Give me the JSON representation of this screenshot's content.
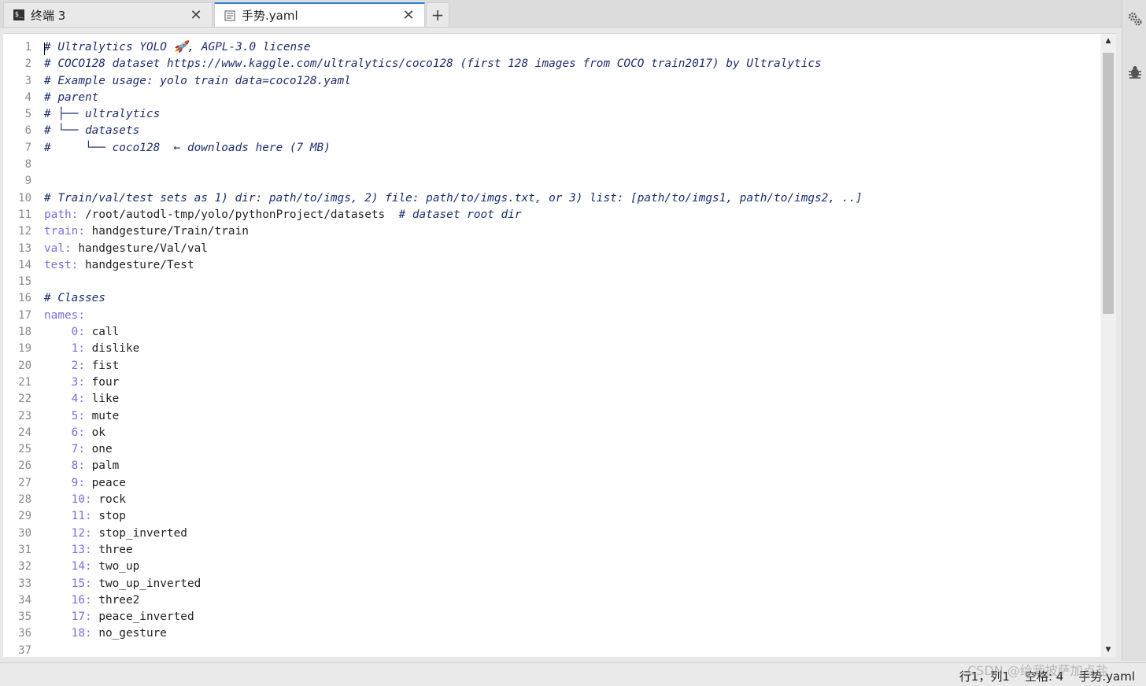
{
  "tabs": [
    {
      "label": "终端 3",
      "icon": "terminal-icon",
      "close": "✕",
      "active": false
    },
    {
      "label": "手势.yaml",
      "icon": "document-icon",
      "close": "✕",
      "active": true
    }
  ],
  "add_tab_label": "+",
  "lines": [
    {
      "n": "1",
      "parts": [
        {
          "t": "# Ultralytics YOLO 🚀, AGPL-3.0 license",
          "c": "comment"
        }
      ]
    },
    {
      "n": "2",
      "parts": [
        {
          "t": "# COCO128 dataset https://www.kaggle.com/ultralytics/coco128 (first 128 images from COCO train2017) by Ultralytics",
          "c": "comment"
        }
      ]
    },
    {
      "n": "3",
      "parts": [
        {
          "t": "# Example usage: yolo train data=coco128.yaml",
          "c": "comment"
        }
      ]
    },
    {
      "n": "4",
      "parts": [
        {
          "t": "# parent",
          "c": "comment"
        }
      ]
    },
    {
      "n": "5",
      "parts": [
        {
          "t": "# ├── ultralytics",
          "c": "comment"
        }
      ]
    },
    {
      "n": "6",
      "parts": [
        {
          "t": "# └── datasets",
          "c": "comment"
        }
      ]
    },
    {
      "n": "7",
      "parts": [
        {
          "t": "#     └── coco128  ← downloads here (7 MB)",
          "c": "comment"
        }
      ]
    },
    {
      "n": "8",
      "parts": []
    },
    {
      "n": "9",
      "parts": []
    },
    {
      "n": "10",
      "parts": [
        {
          "t": "# Train/val/test sets as 1) dir: path/to/imgs, 2) file: path/to/imgs.txt, or 3) list: [path/to/imgs1, path/to/imgs2, ..]",
          "c": "comment"
        }
      ]
    },
    {
      "n": "11",
      "parts": [
        {
          "t": "path:",
          "c": "key"
        },
        {
          "t": " /root/autodl-tmp/yolo/pythonProject/datasets  ",
          "c": "val"
        },
        {
          "t": "# dataset root dir",
          "c": "comment"
        }
      ]
    },
    {
      "n": "12",
      "parts": [
        {
          "t": "train:",
          "c": "key"
        },
        {
          "t": " handgesture/Train/train",
          "c": "val"
        }
      ]
    },
    {
      "n": "13",
      "parts": [
        {
          "t": "val:",
          "c": "key"
        },
        {
          "t": " handgesture/Val/val",
          "c": "val"
        }
      ]
    },
    {
      "n": "14",
      "parts": [
        {
          "t": "test:",
          "c": "key"
        },
        {
          "t": " handgesture/Test",
          "c": "val"
        }
      ]
    },
    {
      "n": "15",
      "parts": []
    },
    {
      "n": "16",
      "parts": [
        {
          "t": "# Classes",
          "c": "comment"
        }
      ]
    },
    {
      "n": "17",
      "parts": [
        {
          "t": "names:",
          "c": "key"
        }
      ]
    },
    {
      "n": "18",
      "parts": [
        {
          "t": "    0:",
          "c": "key"
        },
        {
          "t": " call",
          "c": "val"
        }
      ]
    },
    {
      "n": "19",
      "parts": [
        {
          "t": "    1:",
          "c": "key"
        },
        {
          "t": " dislike",
          "c": "val"
        }
      ]
    },
    {
      "n": "20",
      "parts": [
        {
          "t": "    2:",
          "c": "key"
        },
        {
          "t": " fist",
          "c": "val"
        }
      ]
    },
    {
      "n": "21",
      "parts": [
        {
          "t": "    3:",
          "c": "key"
        },
        {
          "t": " four",
          "c": "val"
        }
      ]
    },
    {
      "n": "22",
      "parts": [
        {
          "t": "    4:",
          "c": "key"
        },
        {
          "t": " like",
          "c": "val"
        }
      ]
    },
    {
      "n": "23",
      "parts": [
        {
          "t": "    5:",
          "c": "key"
        },
        {
          "t": " mute",
          "c": "val"
        }
      ]
    },
    {
      "n": "24",
      "parts": [
        {
          "t": "    6:",
          "c": "key"
        },
        {
          "t": " ok",
          "c": "val"
        }
      ]
    },
    {
      "n": "25",
      "parts": [
        {
          "t": "    7:",
          "c": "key"
        },
        {
          "t": " one",
          "c": "val"
        }
      ]
    },
    {
      "n": "26",
      "parts": [
        {
          "t": "    8:",
          "c": "key"
        },
        {
          "t": " palm",
          "c": "val"
        }
      ]
    },
    {
      "n": "27",
      "parts": [
        {
          "t": "    9:",
          "c": "key"
        },
        {
          "t": " peace",
          "c": "val"
        }
      ]
    },
    {
      "n": "28",
      "parts": [
        {
          "t": "    10:",
          "c": "key"
        },
        {
          "t": " rock",
          "c": "val"
        }
      ]
    },
    {
      "n": "29",
      "parts": [
        {
          "t": "    11:",
          "c": "key"
        },
        {
          "t": " stop",
          "c": "val"
        }
      ]
    },
    {
      "n": "30",
      "parts": [
        {
          "t": "    12:",
          "c": "key"
        },
        {
          "t": " stop_inverted",
          "c": "val"
        }
      ]
    },
    {
      "n": "31",
      "parts": [
        {
          "t": "    13:",
          "c": "key"
        },
        {
          "t": " three",
          "c": "val"
        }
      ]
    },
    {
      "n": "32",
      "parts": [
        {
          "t": "    14:",
          "c": "key"
        },
        {
          "t": " two_up",
          "c": "val"
        }
      ]
    },
    {
      "n": "33",
      "parts": [
        {
          "t": "    15:",
          "c": "key"
        },
        {
          "t": " two_up_inverted",
          "c": "val"
        }
      ]
    },
    {
      "n": "34",
      "parts": [
        {
          "t": "    16:",
          "c": "key"
        },
        {
          "t": " three2",
          "c": "val"
        }
      ]
    },
    {
      "n": "35",
      "parts": [
        {
          "t": "    17:",
          "c": "key"
        },
        {
          "t": " peace_inverted",
          "c": "val"
        }
      ]
    },
    {
      "n": "36",
      "parts": [
        {
          "t": "    18:",
          "c": "key"
        },
        {
          "t": " no_gesture",
          "c": "val"
        }
      ]
    },
    {
      "n": "37",
      "parts": []
    }
  ],
  "scrollbar": {
    "up": "▲",
    "down": "▼"
  },
  "right_panel_icons": [
    "gears-icon",
    "bug-icon"
  ],
  "status": {
    "text": "行1，列1    空格: 4    手势.yaml"
  },
  "watermark": "CSDN @给我披萨加点盐",
  "colors": {
    "comment": "#1d2e6e",
    "key": "#7a70d8",
    "value": "#222222",
    "active_tab_accent": "#2f7fd6"
  }
}
